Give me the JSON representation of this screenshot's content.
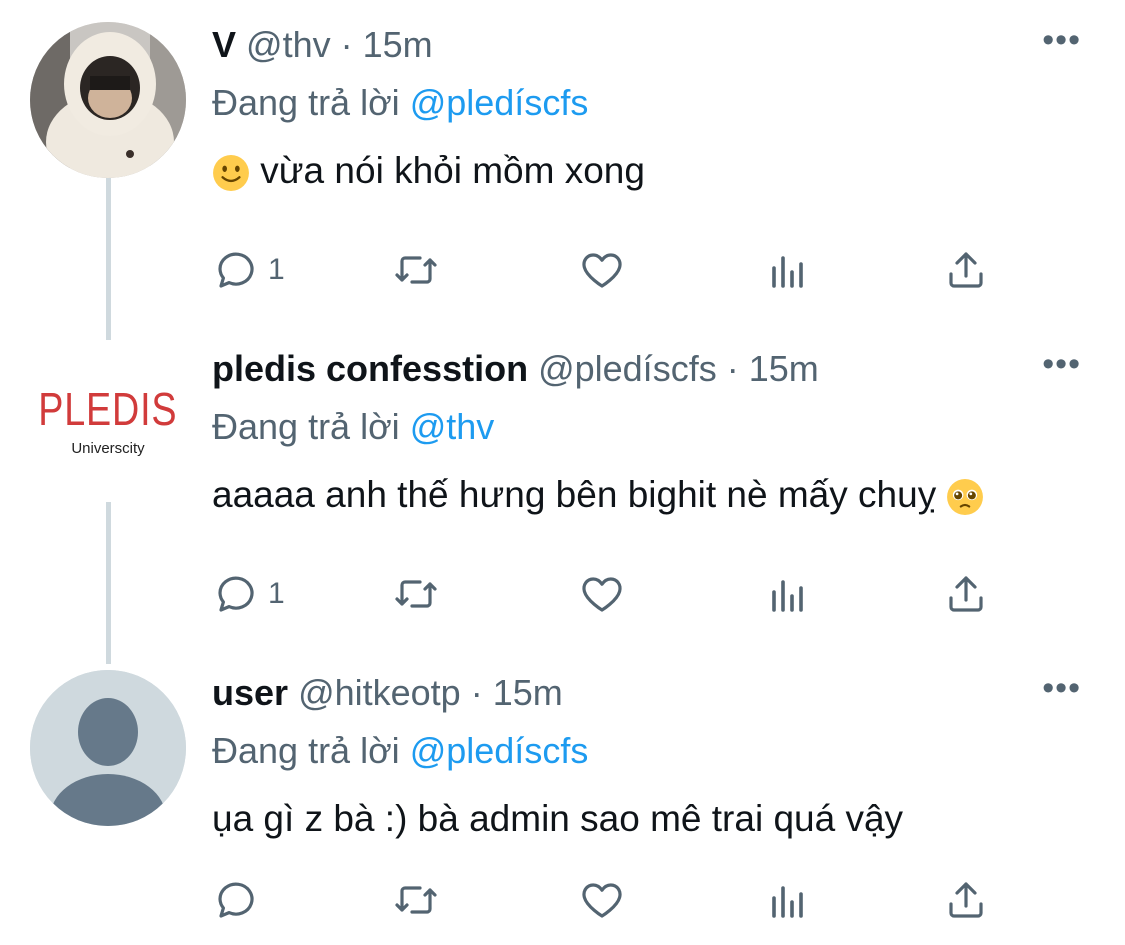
{
  "tweets": [
    {
      "name": "V",
      "handle": "@thv",
      "separator": "·",
      "time": "15m",
      "reply_prefix": "Đang trả lời",
      "reply_to": "@pledíscfs",
      "text": "vừa nói khỏi mồm xong",
      "emoji": "slightly-smiling-face",
      "reply_count": "1",
      "more": "•••"
    },
    {
      "name": "pledis confesstion",
      "handle": "@pledíscfs",
      "separator": "·",
      "time": "15m",
      "reply_prefix": "Đang trả lời",
      "reply_to": "@thv",
      "text": "aaaaa anh thế hưng bên bighit nè mấy chuỵ",
      "emoji": "pleading-face",
      "reply_count": "1",
      "more": "•••",
      "logo_text": "PLEDIS",
      "logo_subtext": "Universcity"
    },
    {
      "name": "user",
      "handle": "@hitkeotp",
      "separator": "·",
      "time": "15m",
      "reply_prefix": "Đang trả lời",
      "reply_to": "@pledíscfs",
      "text": "ụa gì z bà :) bà admin sao mê trai quá vậy",
      "reply_count": "",
      "more": "•••"
    }
  ],
  "colors": {
    "link": "#1d9bf0",
    "secondary": "#536471",
    "thread_line": "#cfd9de",
    "logo_red": "#d13b3b"
  }
}
